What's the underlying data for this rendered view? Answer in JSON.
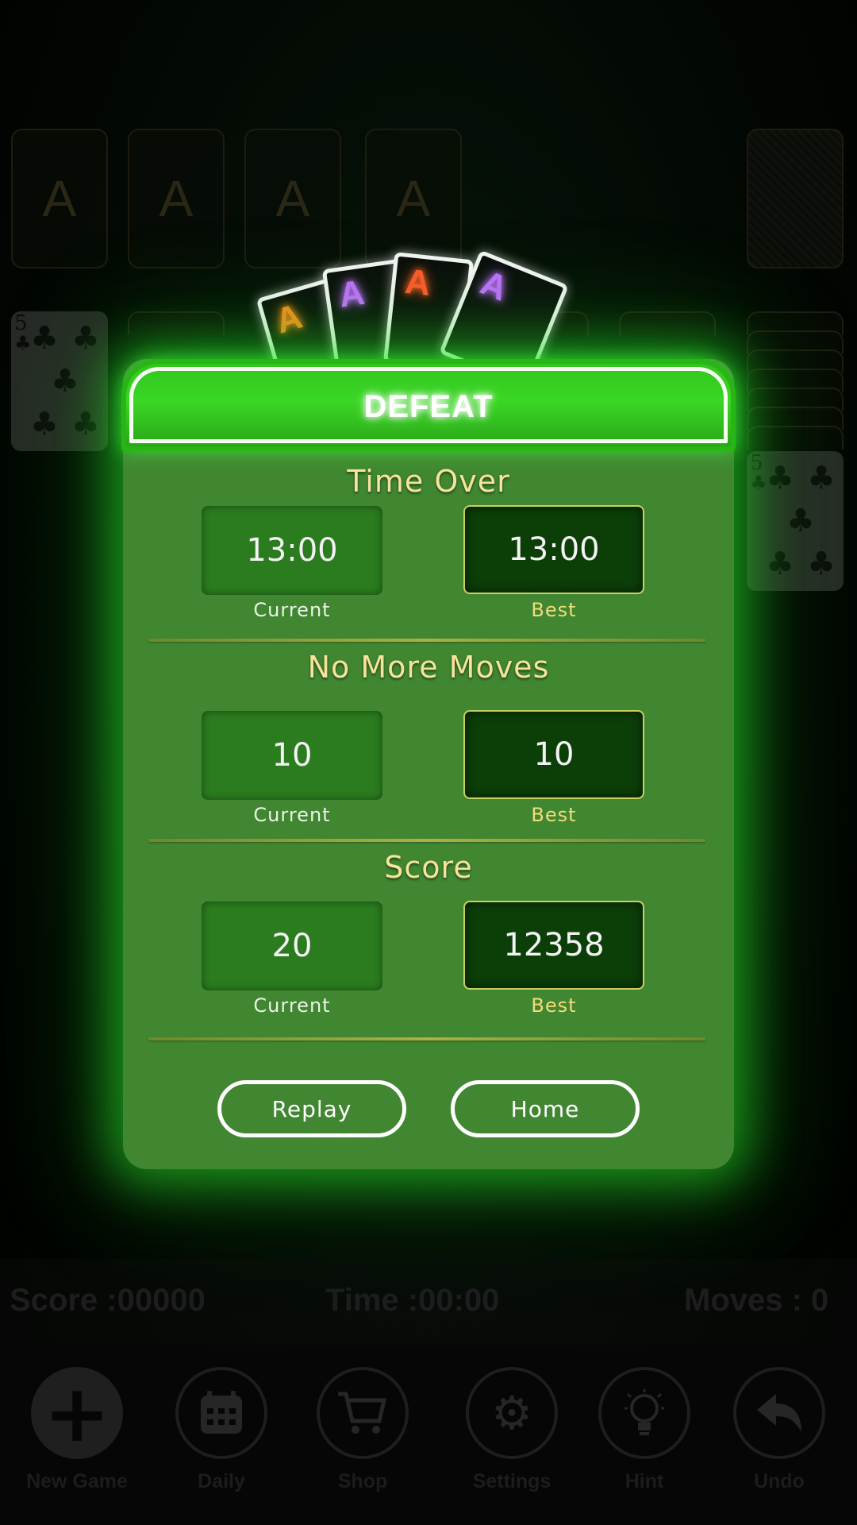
{
  "board": {
    "foundation_labels": [
      "A",
      "A",
      "A",
      "A"
    ],
    "left_card": {
      "rank": "5",
      "suit": "♣"
    },
    "right_card": {
      "rank": "5",
      "suit": "♣"
    }
  },
  "floating_aces": [
    {
      "label": "A",
      "color": "#ff8a1e"
    },
    {
      "label": "A",
      "color": "#c070ff"
    },
    {
      "label": "A",
      "color": "#ff5a2a"
    },
    {
      "label": "A",
      "color": "#c070ff"
    }
  ],
  "dialog": {
    "title": "DEFEAT",
    "sections": [
      {
        "title": "Time Over",
        "current_value": "13:00",
        "current_label": "Current",
        "best_value": "13:00",
        "best_label": "Best"
      },
      {
        "title": "No More Moves",
        "current_value": "10",
        "current_label": "Current",
        "best_value": "10",
        "best_label": "Best"
      },
      {
        "title": "Score",
        "current_value": "20",
        "current_label": "Current",
        "best_value": "12358",
        "best_label": "Best"
      }
    ],
    "buttons": {
      "replay": "Replay",
      "home": "Home"
    }
  },
  "hud": {
    "score": "Score :00000",
    "time": "Time :00:00",
    "moves": "Moves : 0"
  },
  "toolbar": [
    {
      "label": "New Game",
      "icon": "plus-icon"
    },
    {
      "label": "Daily",
      "icon": "calendar-icon"
    },
    {
      "label": "Shop",
      "icon": "cart-icon"
    },
    {
      "label": "Settings",
      "icon": "gear-icon"
    },
    {
      "label": "Hint",
      "icon": "lightbulb-icon"
    },
    {
      "label": "Undo",
      "icon": "undo-icon"
    }
  ]
}
